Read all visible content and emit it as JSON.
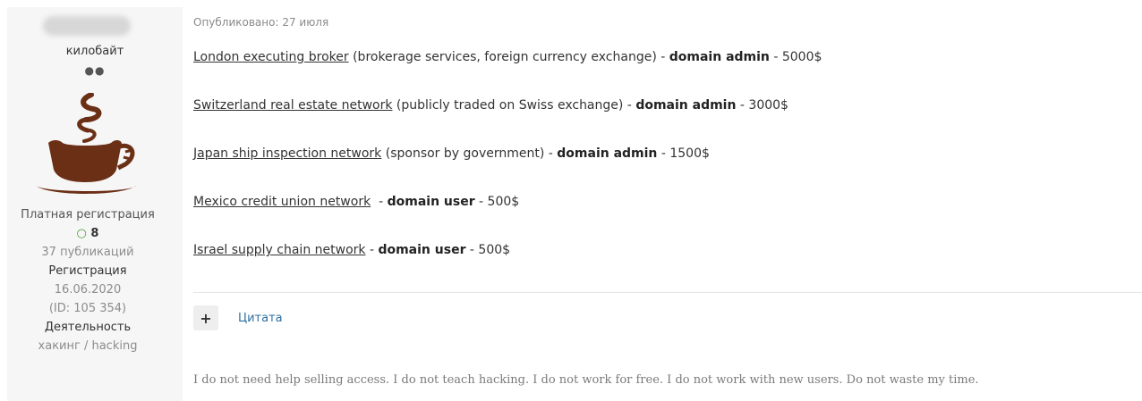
{
  "user": {
    "rank": "килобайт",
    "rank_dots": "●●",
    "avatar_icon": "coffee-cup-icon",
    "group": "Платная регистрация",
    "reputation_icon": "○",
    "reputation": "8",
    "posts": "37 публикаций",
    "registration_label": "Регистрация",
    "registration_date": "16.06.2020",
    "id": "(ID: 105 354)",
    "activity_label": "Деятельность",
    "activity": "хакинг / hacking"
  },
  "post": {
    "published": "Опубликовано: 27 июля",
    "offers": [
      {
        "link": "London executing broker",
        "desc": " (brokerage services, foreign currency exchange) - ",
        "access": "domain admin",
        "price": " - 5000$"
      },
      {
        "link": "Switzerland real estate network",
        "desc": " (publicly traded on Swiss exchange) - ",
        "access": "domain admin",
        "price": " - 3000$"
      },
      {
        "link": "Japan ship inspection network",
        "desc": " (sponsor by government) - ",
        "access": "domain admin",
        "price": " - 1500$"
      },
      {
        "link": "Mexico credit union network",
        "desc": "  - ",
        "access": "domain user",
        "price": " - 500$"
      },
      {
        "link": "Israel supply chain network",
        "desc": " - ",
        "access": "domain user",
        "price": " - 500$"
      }
    ],
    "quote_plus": "+",
    "quote_label": "Цитата",
    "signature": "I do not need help selling access. I do not teach hacking. I do not work for free. I do not work with new users. Do not waste my time."
  },
  "colors": {
    "sidebar_bg": "#f6f6f6",
    "link": "#333333",
    "quote_link": "#2f6f9f",
    "reputation": "#4a9a37",
    "avatar": "#6b2f16"
  }
}
